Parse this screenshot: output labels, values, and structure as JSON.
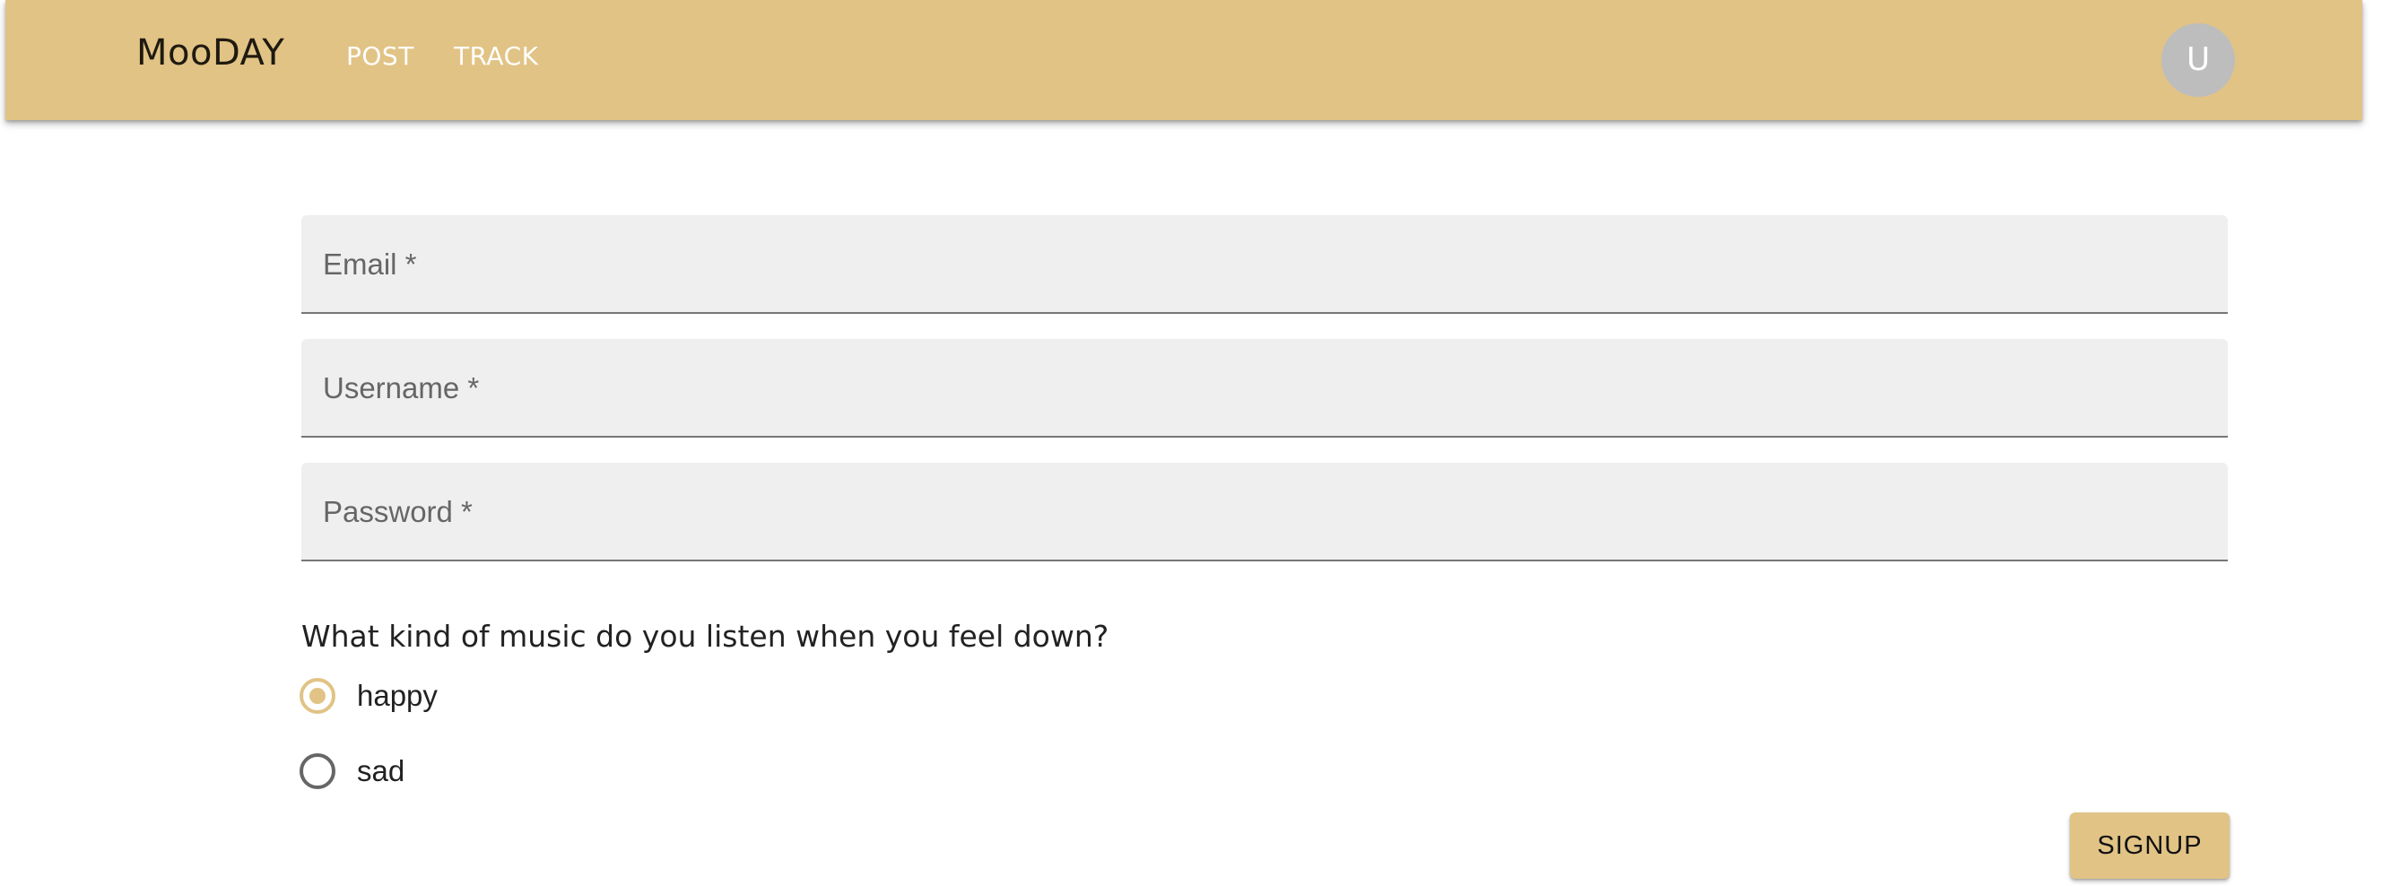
{
  "header": {
    "brand": "MooDAY",
    "nav": {
      "post": "POST",
      "track": "TRACK"
    },
    "avatar_initial": "U"
  },
  "form": {
    "email_label": "Email *",
    "username_label": "Username *",
    "password_label": "Password *",
    "question": "What kind of music do you listen when you feel down?",
    "options": [
      {
        "label": "happy",
        "selected": true
      },
      {
        "label": "sad",
        "selected": false
      }
    ],
    "submit_label": "SIGNUP"
  },
  "colors": {
    "accent": "#E1C385",
    "field_background": "#EFEFEF",
    "avatar": "#BDBDBD"
  }
}
